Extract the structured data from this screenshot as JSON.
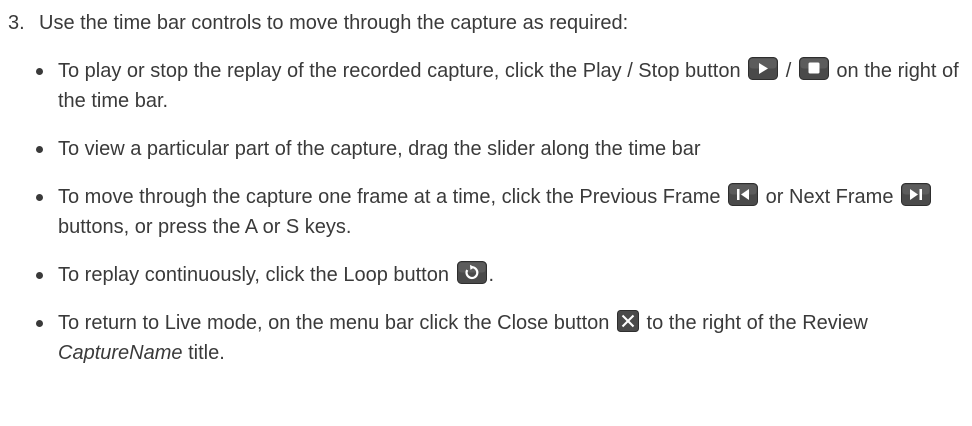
{
  "step": {
    "number": "3.",
    "text": "Use the time bar controls to move through the capture as required:"
  },
  "bullets": [
    {
      "before": "To play or stop the replay of the recorded capture, click the Play / Stop button",
      "separator": "/",
      "after": "on the right of the time bar.",
      "icons": [
        "play-icon",
        "stop-icon"
      ]
    },
    {
      "text": "To view a particular part of the capture, drag the slider along the time bar"
    },
    {
      "before": "To move through the capture one frame at a time, click the Previous Frame",
      "middle": "or Next Frame",
      "after": "buttons, or press the A or S keys.",
      "icons": [
        "previous-frame-icon",
        "next-frame-icon"
      ]
    },
    {
      "before": "To replay continuously, click the Loop button",
      "after": ".",
      "icons": [
        "loop-icon"
      ]
    },
    {
      "before": "To return to Live mode, on the menu bar click the Close button",
      "after_1": "to the right of the Review",
      "italic": "CaptureName",
      "after_2": "title.",
      "icons": [
        "close-icon"
      ]
    }
  ],
  "colors": {
    "text": "#3a3a3a",
    "button_bg": "#4a4a4a",
    "button_fg": "#ffffff"
  }
}
